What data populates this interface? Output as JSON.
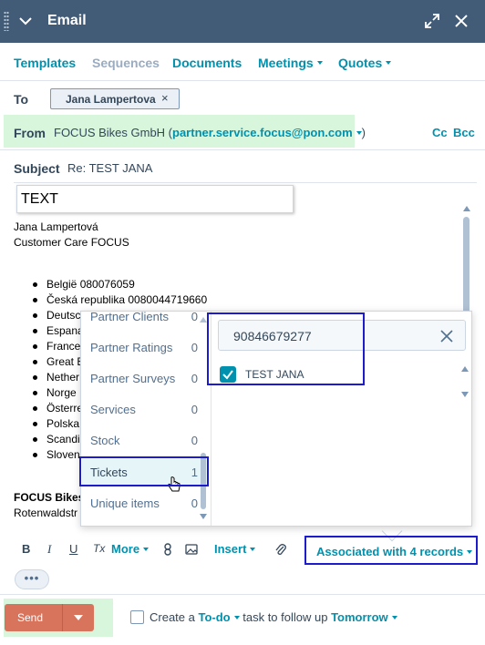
{
  "header": {
    "title": "Email"
  },
  "toolbar": {
    "templates": "Templates",
    "sequences": "Sequences",
    "documents": "Documents",
    "meetings": "Meetings",
    "quotes": "Quotes"
  },
  "to": {
    "label": "To",
    "recipient": "Jana Lampertova"
  },
  "from": {
    "label": "From",
    "name": "FOCUS Bikes GmbH (",
    "email": "partner.service.focus@pon.com",
    "close_paren": ")",
    "cc": "Cc",
    "bcc": "Bcc"
  },
  "subject": {
    "label": "Subject",
    "value": "Re: TEST JANA"
  },
  "body": {
    "text_box": "TEXT",
    "lines": [
      "Jana Lampertová",
      "Customer Care FOCUS"
    ],
    "list": [
      "België 080076059",
      "Česká republika 0080044719660",
      "Deutsc",
      "Espana",
      "France",
      "Great B",
      "Nether",
      "Norge",
      "Österre",
      "Polska",
      "Scandi",
      "Sloven"
    ],
    "signature_company": "FOCUS Bikes",
    "signature_address": "Rotenwaldstr"
  },
  "associations": {
    "objects": [
      {
        "label": "Partner Clients",
        "count": "0"
      },
      {
        "label": "Partner Ratings",
        "count": "0"
      },
      {
        "label": "Partner Surveys",
        "count": "0"
      },
      {
        "label": "Services",
        "count": "0"
      },
      {
        "label": "Stock",
        "count": "0"
      },
      {
        "label": "Tickets",
        "count": "1"
      },
      {
        "label": "Unique items",
        "count": "0"
      }
    ],
    "search_value": "90846679277",
    "result": "TEST JANA"
  },
  "format_bar": {
    "bold": "B",
    "italic": "I",
    "underline": "U",
    "clear": "Tx",
    "more": "More",
    "insert": "Insert",
    "associated": "Associated with 4 records",
    "overflow": "•••"
  },
  "footer": {
    "send": "Send",
    "todo_prefix": "Create a ",
    "todo_type": "To-do",
    "todo_middle": " task to follow up ",
    "todo_when": "Tomorrow"
  },
  "colors": {
    "header_bg": "#425b76",
    "link": "#0091ae",
    "send": "#d9745c",
    "highlight_green": "#d8f6dc",
    "annotation_blue": "#1c1ccc"
  }
}
